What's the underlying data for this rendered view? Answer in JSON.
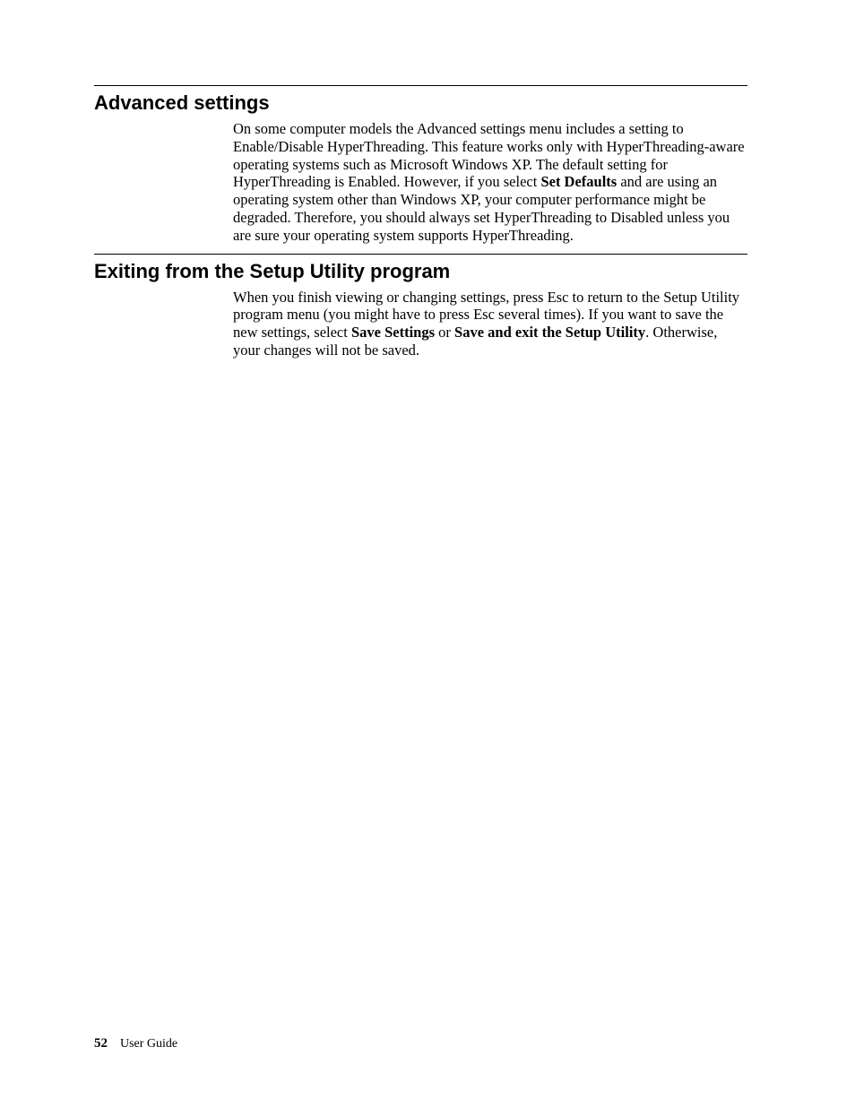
{
  "sections": {
    "advanced": {
      "heading": "Advanced settings",
      "p1_a": "On some computer models the Advanced settings menu includes a setting to Enable/Disable HyperThreading. This feature works only with HyperThreading-aware operating systems such as Microsoft Windows XP. The default setting for HyperThreading is Enabled. However, if you select ",
      "p1_bold1": "Set Defaults",
      "p1_b": " and are using an operating system other than Windows XP, your computer performance might be degraded. Therefore, you should always set HyperThreading to Disabled unless you are sure your operating system supports HyperThreading."
    },
    "exiting": {
      "heading": "Exiting from the Setup Utility program",
      "p1_a": "When you finish viewing or changing settings, press Esc to return to the Setup Utility program menu (you might have to press Esc several times). If you want to save the new settings, select ",
      "p1_bold1": "Save Settings",
      "p1_b": " or ",
      "p1_bold2": "Save and exit the Setup Utility",
      "p1_c": ". Otherwise, your changes will not be saved."
    }
  },
  "footer": {
    "page_number": "52",
    "title": "User Guide"
  }
}
